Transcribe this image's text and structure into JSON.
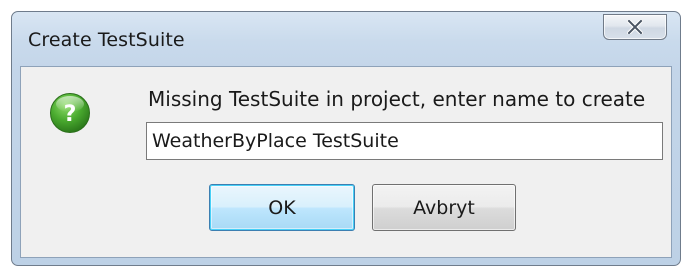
{
  "window": {
    "title": "Create TestSuite"
  },
  "dialog": {
    "icon": "question-icon",
    "message": "Missing TestSuite in project, enter name to create",
    "input_value": "WeatherByPlace TestSuite"
  },
  "buttons": {
    "ok_label": "OK",
    "cancel_label": "Avbryt"
  },
  "colors": {
    "accent_green": "#3a9a2a",
    "ok_border": "#3c7fb1"
  }
}
